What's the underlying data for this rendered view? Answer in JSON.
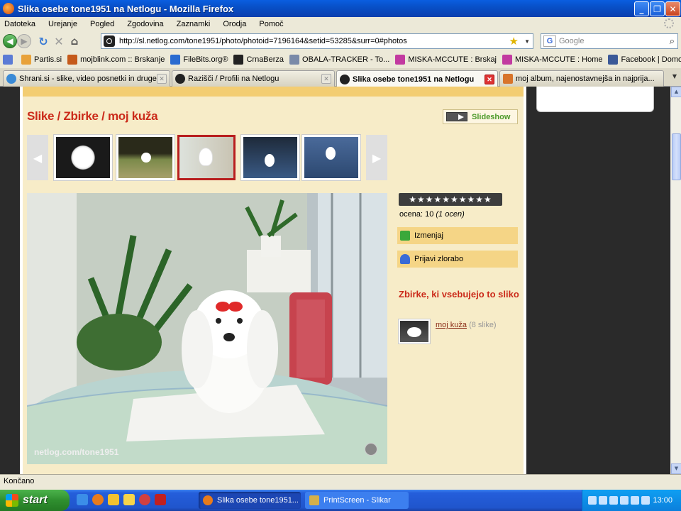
{
  "window": {
    "title": "Slika osebe tone1951 na Netlogu - Mozilla Firefox"
  },
  "menu": [
    "Datoteka",
    "Urejanje",
    "Pogled",
    "Zgodovina",
    "Zaznamki",
    "Orodja",
    "Pomoč"
  ],
  "nav": {
    "url": "http://sl.netlog.com/tone1951/photo/photoid=7196164&setid=53285&surr=0#photos",
    "search_placeholder": "Google"
  },
  "bookmarks": [
    {
      "label": "",
      "color": "#5b7bd5"
    },
    {
      "label": "Partis.si",
      "color": "#e8a23a"
    },
    {
      "label": "mojblink.com :: Brskanje",
      "color": "#c55a1a"
    },
    {
      "label": "FileBits.org®",
      "color": "#2a6bd0"
    },
    {
      "label": "CrnaBerza",
      "color": "#222222"
    },
    {
      "label": "OBALA-TRACKER - To...",
      "color": "#7a8aa8"
    },
    {
      "label": "MISKA-MCCUTE : Brskaj",
      "color": "#c23aa0"
    },
    {
      "label": "MISKA-MCCUTE : Home",
      "color": "#c23aa0"
    },
    {
      "label": "Facebook | Domov",
      "color": "#3b5998"
    }
  ],
  "tabs": [
    {
      "label": "Shrani.si - slike, video posnetki in druge...",
      "icon_color": "#3a8ad6"
    },
    {
      "label": "Razišči / Profili na Netlogu",
      "icon_color": "#222222"
    },
    {
      "label": "Slika osebe tone1951 na Netlogu",
      "icon_color": "#222222"
    },
    {
      "label": "moj album, najenostavnejša in najprija...",
      "icon_color": "#d8742a"
    }
  ],
  "page": {
    "heading": "Slike / Zbirke / moj kuža",
    "slideshow_label": "Slideshow",
    "watermark": "netlog.com/tone1951",
    "stars": "★★★★★★★★★★",
    "rating_label": "ocena: 10",
    "rating_count": "(1 ocen)",
    "actions": [
      {
        "label": "Izmenjaj",
        "icon": "shuffle-icon",
        "icon_color": "#3aa83a"
      },
      {
        "label": "Prijavi zlorabo",
        "icon": "user-report-icon",
        "icon_color": "#3a6bd6"
      }
    ],
    "collections_heading": "Zbirke, ki vsebujejo to sliko",
    "collection": {
      "name": "moj kuža",
      "count": "(8 slike)"
    }
  },
  "status": {
    "text": "Končano"
  },
  "taskbar": {
    "start_label": "start",
    "tasks": [
      {
        "label": "Slika osebe tone1951...",
        "icon_color": "#e87b1c"
      },
      {
        "label": "PrintScreen - Slikar",
        "icon_color": "#d4b04a"
      }
    ],
    "clock": "13:00"
  }
}
